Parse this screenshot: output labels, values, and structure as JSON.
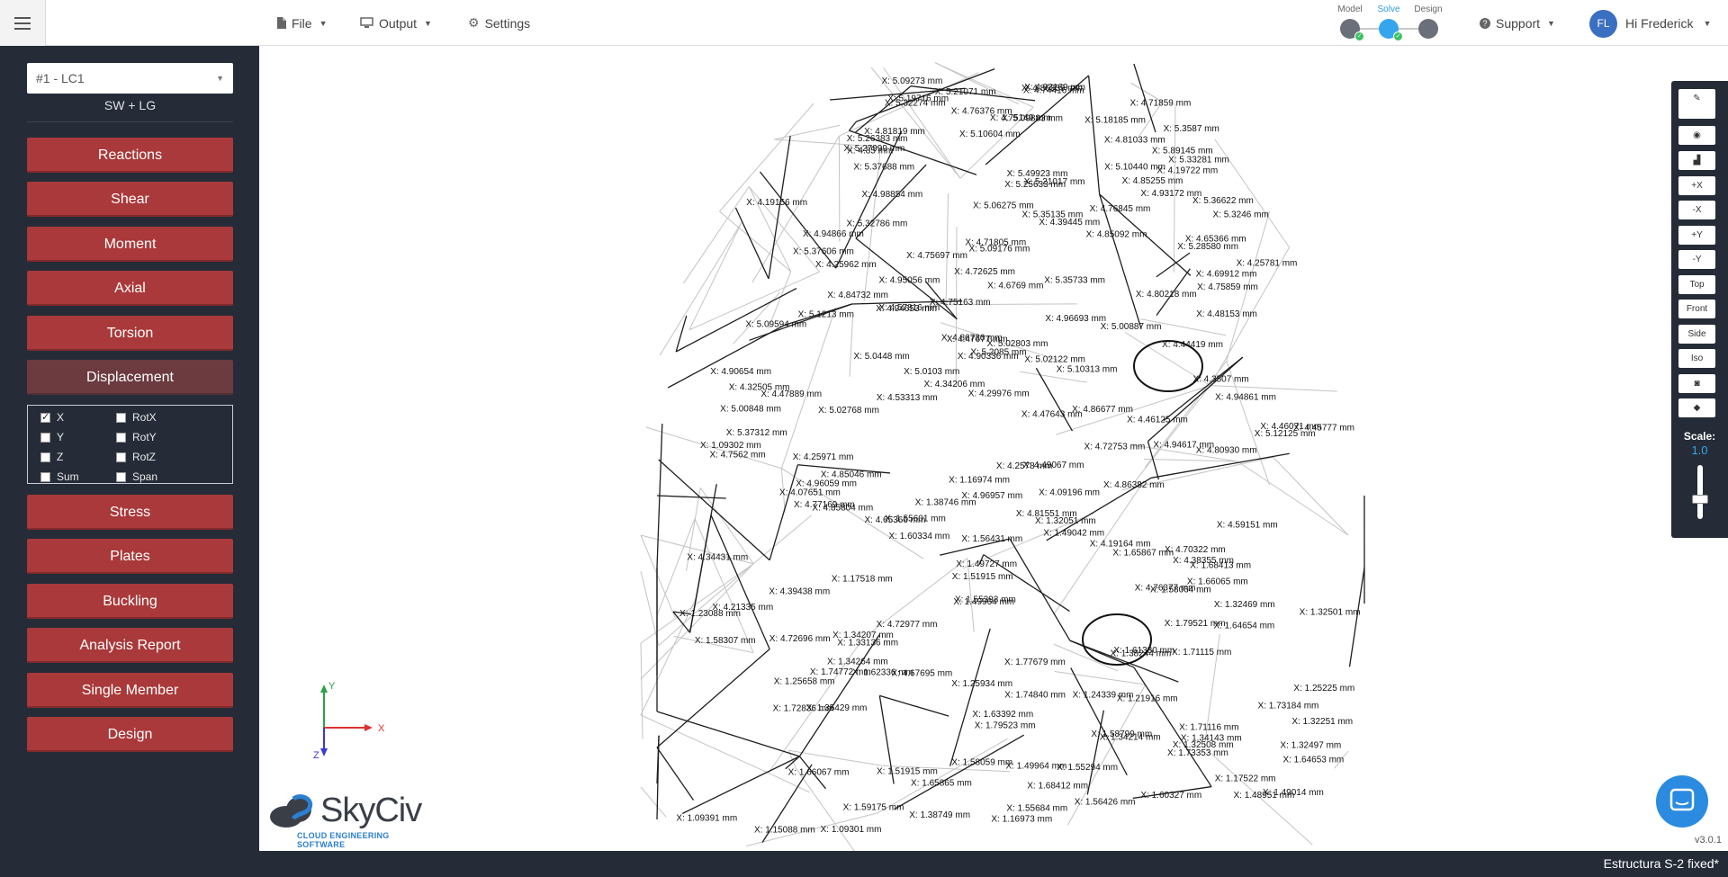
{
  "menu": {
    "file": "File",
    "output": "Output",
    "settings": "Settings",
    "support": "Support",
    "user_greeting": "Hi Frederick",
    "user_initials": "FL"
  },
  "workflow": {
    "model": "Model",
    "solve": "Solve",
    "design": "Design",
    "active_step": "Solve"
  },
  "sidebar": {
    "load_combo": "#1 - LC1",
    "load_combo_desc": "SW + LG",
    "buttons": {
      "reactions": "Reactions",
      "shear": "Shear",
      "moment": "Moment",
      "axial": "Axial",
      "torsion": "Torsion",
      "displacement": "Displacement",
      "stress": "Stress",
      "plates": "Plates",
      "buckling": "Buckling",
      "analysis_report": "Analysis Report",
      "single_member": "Single Member",
      "design": "Design"
    },
    "displacement_options": [
      {
        "label": "X",
        "checked": true
      },
      {
        "label": "RotX",
        "checked": false
      },
      {
        "label": "Y",
        "checked": false
      },
      {
        "label": "RotY",
        "checked": false
      },
      {
        "label": "Z",
        "checked": false
      },
      {
        "label": "RotZ",
        "checked": false
      },
      {
        "label": "Sum",
        "checked": false
      },
      {
        "label": "Span",
        "checked": false
      }
    ]
  },
  "tools": {
    "plus_x": "+X",
    "minus_x": "-X",
    "plus_y": "+Y",
    "minus_y": "-Y",
    "top": "Top",
    "front": "Front",
    "side": "Side",
    "iso": "Iso",
    "scale_label": "Scale:",
    "scale_value": "1.0"
  },
  "axes": {
    "x": "X",
    "y": "Y",
    "z": "Z"
  },
  "viewport_labels": [
    "X: 5.09273 mm",
    "X: 4.93169 mm",
    "X: 4.86359 mm",
    "X: 4.74416 mm",
    "X: 5.21071 mm",
    "X: 5.19716 mm",
    "X: 5.32274 mm",
    "X: 4.71859 mm",
    "X: 4.76376 mm",
    "X: 4.75149 mm",
    "X: 5.09883 mm",
    "X: 5.18185 mm",
    "X: 5.3587 mm",
    "X: 5.10604 mm",
    "X: 4.81819 mm",
    "X: 4.81033 mm",
    "X: 5.26383 mm",
    "X: 5.27999 mm",
    "X: 5.89145 mm",
    "X: 4.85 mm",
    "X: 5.33281 mm",
    "X: 5.10440 mm",
    "X: 5.37688 mm",
    "X: 5.49923 mm",
    "X: 4.19722 mm",
    "X: 4.85255 mm",
    "X: 5.21017 mm",
    "X: 5.25633 mm",
    "X: 4.98854 mm",
    "X: 4.93172 mm",
    "X: 5.36622 mm",
    "X: 5.06275 mm",
    "X: 4.19156 mm",
    "X: 4.76845 mm",
    "X: 5.35135 mm",
    "X: 5.3246 mm",
    "X: 5.32786 mm",
    "X: 4.39445 mm",
    "X: 4.85092 mm",
    "X: 4.94866 mm",
    "X: 4.71805 mm",
    "X: 4.65366 mm",
    "X: 5.28580 mm",
    "X: 5.09176 mm",
    "X: 5.37606 mm",
    "X: 4.75697 mm",
    "X: 4.25781 mm",
    "X: 4.25962 mm",
    "X: 4.69912 mm",
    "X: 4.72625 mm",
    "X: 4.95056 mm",
    "X: 5.35733 mm",
    "X: 4.75859 mm",
    "X: 4.6769 mm",
    "X: 4.84732 mm",
    "X: 4.80218 mm",
    "X: 4.75163 mm",
    "X: 4.57816 mm",
    "X: 4.94653 mm",
    "X: 4.48153 mm",
    "X: 5.1213 mm",
    "X: 4.96693 mm",
    "X: 5.09594 mm",
    "X: 5.00887 mm",
    "X: 4.86736 mm",
    "X: 4.47677 mm",
    "X: 4.44419 mm",
    "X: 5.02803 mm",
    "X: 5.2085 mm",
    "X: 4.90336 mm",
    "X: 5.0448 mm",
    "X: 5.02122 mm",
    "X: 5.10313 mm",
    "X: 5.0103 mm",
    "X: 4.90654 mm",
    "X: 4.3507 mm",
    "X: 4.34206 mm",
    "X: 4.32505 mm",
    "X: 4.29976 mm",
    "X: 4.94861 mm",
    "X: 4.47889 mm",
    "X: 4.53313 mm",
    "X: 4.86677 mm",
    "X: 5.02768 mm",
    "X: 5.00848 mm",
    "X: 4.47643 mm",
    "X: 4.46125 mm",
    "X: 4.46071 mm",
    "X: 4.45777 mm",
    "X: 5.12125 mm",
    "X: 5.37312 mm",
    "X: 4.94617 mm",
    "X: 1.09302 mm",
    "X: 4.72753 mm",
    "X: 4.80930 mm",
    "X: 4.7562 mm",
    "X: 4.25971 mm",
    "X: 4.2578 mm",
    "X: 4.49067 mm",
    "X: 4.85046 mm",
    "X: 1.16974 mm",
    "X: 4.86382 mm",
    "X: 4.96059 mm",
    "X: 4.09196 mm",
    "X: 4.07651 mm",
    "X: 4.96957 mm",
    "X: 1.38746 mm",
    "X: 4.77169 mm",
    "X: 4.85804 mm",
    "X: 4.81551 mm",
    "X: 1.55601 mm",
    "X: 1.32051 mm",
    "X: 4.65366 mm",
    "X: 4.59151 mm",
    "X: 1.49042 mm",
    "X: 1.60334 mm",
    "X: 1.56431 mm",
    "X: 4.19164 mm",
    "X: 4.70322 mm",
    "X: 1.65867 mm",
    "X: 4.34431 mm",
    "X: 4.38355 mm",
    "X: 1.68413 mm",
    "X: 1.49727 mm",
    "X: 1.51915 mm",
    "X: 1.17518 mm",
    "X: 1.66065 mm",
    "X: 4.76377 mm",
    "X: 4.39438 mm",
    "X: 1.58064 mm",
    "X: 1.55393 mm",
    "X: 1.49964 mm",
    "X: 1.32469 mm",
    "X: 4.21335 mm",
    "X: 1.23088 mm",
    "X: 1.32501 mm",
    "X: 1.79521 mm",
    "X: 4.72977 mm",
    "X: 1.64654 mm",
    "X: 1.34207 mm",
    "X: 4.72696 mm",
    "X: 1.58307 mm",
    "X: 1.33136 mm",
    "X: 1.71115 mm",
    "X: 1.61330 mm",
    "X: 1.38244 mm",
    "X: 1.34264 mm",
    "X: 1.77679 mm",
    "X: 1.74772 mm",
    "X: 4.67695 mm",
    "X: 1.62336 mm",
    "X: 1.25658 mm",
    "X: 1.25934 mm",
    "X: 1.25225 mm",
    "X: 1.24339 mm",
    "X: 1.21916 mm",
    "X: 1.74840 mm",
    "X: 1.73184 mm",
    "X: 1.72836 mm",
    "X: 1.35429 mm",
    "X: 1.63392 mm",
    "X: 1.32251 mm",
    "X: 1.79523 mm",
    "X: 1.71116 mm",
    "X: 1.58799 mm",
    "X: 1.34143 mm",
    "X: 1.34214 mm",
    "X: 1.32508 mm",
    "X: 1.32497 mm",
    "X: 1.73353 mm",
    "X: 1.64653 mm",
    "X: 1.58059 mm",
    "X: 1.55294 mm",
    "X: 1.49964 mm",
    "X: 1.66067 mm",
    "X: 1.51915 mm",
    "X: 1.17522 mm",
    "X: 1.68412 mm",
    "X: 1.65865 mm",
    "X: 1.48951 mm",
    "X: 1.49014 mm",
    "X: 1.60327 mm",
    "X: 1.56426 mm",
    "X: 1.59175 mm",
    "X: 1.55684 mm",
    "X: 1.38749 mm",
    "X: 1.09391 mm",
    "X: 1.16973 mm",
    "X: 1.15088 mm",
    "X: 1.09301 mm"
  ],
  "logo": {
    "name": "SkyCiv",
    "tagline": "CLOUD ENGINEERING SOFTWARE"
  },
  "version": "v3.0.1",
  "status": {
    "file_name": "Estructura S-2 fixed*"
  },
  "colors": {
    "sidebar_bg": "#252c38",
    "button_red": "#a9393a",
    "accent_blue": "#2f9be6"
  }
}
